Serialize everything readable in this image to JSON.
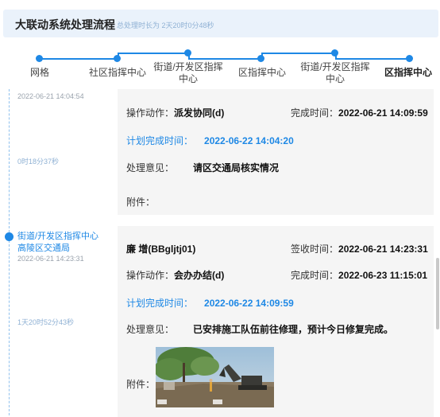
{
  "header": {
    "title": "大联动系统处理流程",
    "total_time": "总处理时长为 2天20时0分48秒"
  },
  "steps": [
    {
      "label": "网格"
    },
    {
      "label": "社区指挥中心"
    },
    {
      "label": "街道/开发区指挥\n中心"
    },
    {
      "label": "区指挥中心"
    },
    {
      "label": "街道/开发区指挥\n中心"
    },
    {
      "label": "区指挥中心"
    }
  ],
  "timeline": {
    "entry1": {
      "time": "2022-06-21 14:04:54",
      "duration": "0时18分37秒",
      "action_label": "操作动作：",
      "action": "派发协同(d)",
      "complete_label": "完成时间：",
      "complete_time": "2022-06-21 14:09:59",
      "plan_label": "计划完成时间：",
      "plan_time": "2022-06-22 14:04:20",
      "opinion_label": "处理意见：",
      "opinion": "请区交通局核实情况",
      "attach_label": "附件："
    },
    "entry2": {
      "dept": "街道/开发区指挥中心",
      "org": "高陵区交通局",
      "time": "2022-06-21 14:23:31",
      "duration": "1天20时52分43秒",
      "person": "廉 增(BBgljtj01)",
      "sign_label": "签收时间：",
      "sign_time": "2022-06-21 14:23:31",
      "action_label": "操作动作：",
      "action": "会办办结(d)",
      "complete_label": "完成时间：",
      "complete_time": "2022-06-23 11:15:01",
      "plan_label": "计划完成时间：",
      "plan_time": "2022-06-22 14:09:59",
      "opinion_label": "处理意见：",
      "opinion": "已安排施工队伍前往修理，预计今日修复完成。",
      "attach_label": "附件："
    }
  },
  "colors": {
    "accent": "#1e88e5",
    "header_bg": "#eaf2fb",
    "card_bg": "#f5f5f5"
  }
}
